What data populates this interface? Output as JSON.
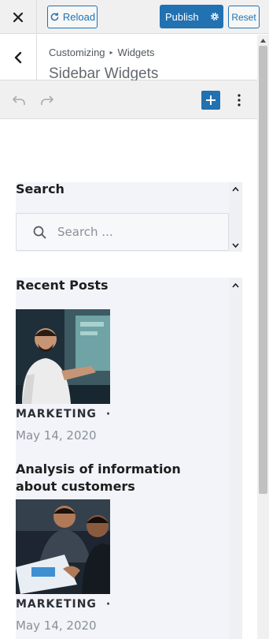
{
  "header": {
    "reload_label": "Reload",
    "publish_label": "Publish",
    "reset_label": "Reset"
  },
  "section": {
    "breadcrumb_root": "Customizing",
    "breadcrumb_current": "Widgets",
    "title": "Sidebar Widgets"
  },
  "widgets": {
    "search": {
      "title": "Search",
      "placeholder": "Search ..."
    },
    "recent_posts": {
      "title": "Recent Posts",
      "posts": [
        {
          "category": "MARKETING",
          "separator": "·",
          "date": "May 14, 2020",
          "title": ""
        },
        {
          "category": "MARKETING",
          "separator": "·",
          "date": "May 14, 2020",
          "title": "Analysis of information about customers"
        }
      ]
    }
  },
  "colors": {
    "accent": "#2271b1",
    "widget_bg": "#f2f4f9",
    "chrome_bg": "#f0f0f1"
  }
}
